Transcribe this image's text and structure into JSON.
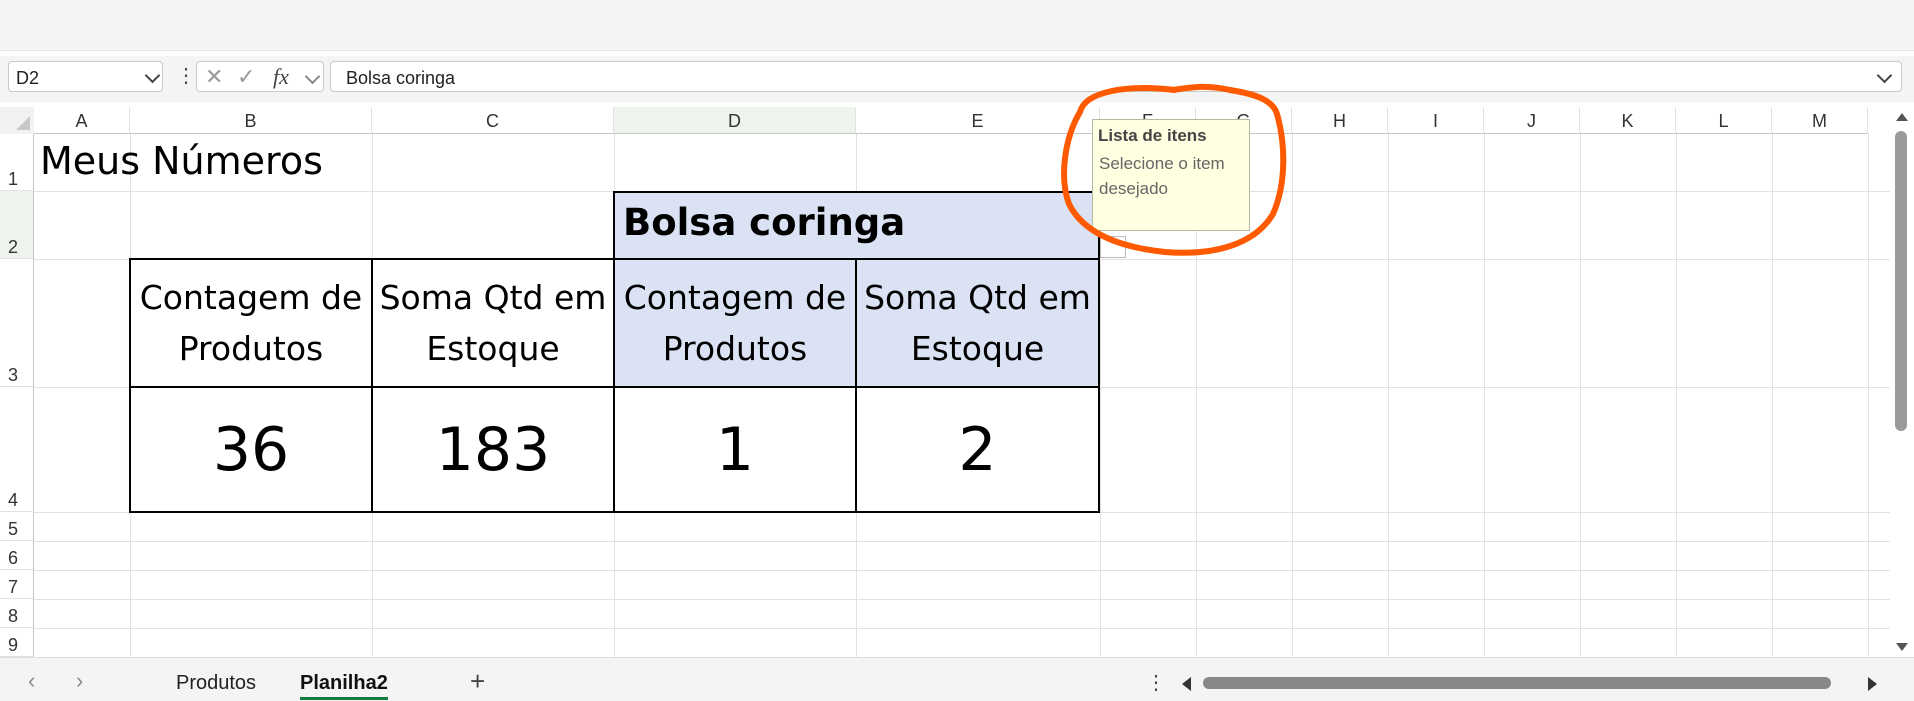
{
  "formula_bar": {
    "name_box": "D2",
    "formula": "Bolsa coringa",
    "fx_label": "fx",
    "cancel_glyph": "✕",
    "enter_glyph": "✓",
    "more_glyph": "⋮"
  },
  "columns": [
    "A",
    "B",
    "C",
    "D",
    "E",
    "F",
    "G",
    "H",
    "I",
    "J",
    "K",
    "L",
    "M"
  ],
  "rows": [
    "1",
    "2",
    "3",
    "4",
    "5",
    "6",
    "7",
    "8",
    "9"
  ],
  "sheet": {
    "title": "Meus Números",
    "group_header": "Bolsa coringa",
    "headers": [
      "Contagem de Produtos",
      "Soma Qtd em Estoque",
      "Contagem de Produtos",
      "Soma Qtd em Estoque"
    ],
    "values": [
      "36",
      "183",
      "1",
      "2"
    ]
  },
  "tooltip": {
    "title": "Lista de itens",
    "body": "Selecione o item desejado"
  },
  "sheet_tabs": [
    {
      "label": "Produtos",
      "active": false
    },
    {
      "label": "Planilha2",
      "active": true
    }
  ],
  "tab_bar": {
    "add_glyph": "+",
    "prev_glyph": "‹",
    "next_glyph": "›",
    "more_glyph": "⋮"
  },
  "colors": {
    "header_fill": "#dae2f3",
    "annotation": "#ff5a00",
    "active_tab": "#107c41"
  }
}
